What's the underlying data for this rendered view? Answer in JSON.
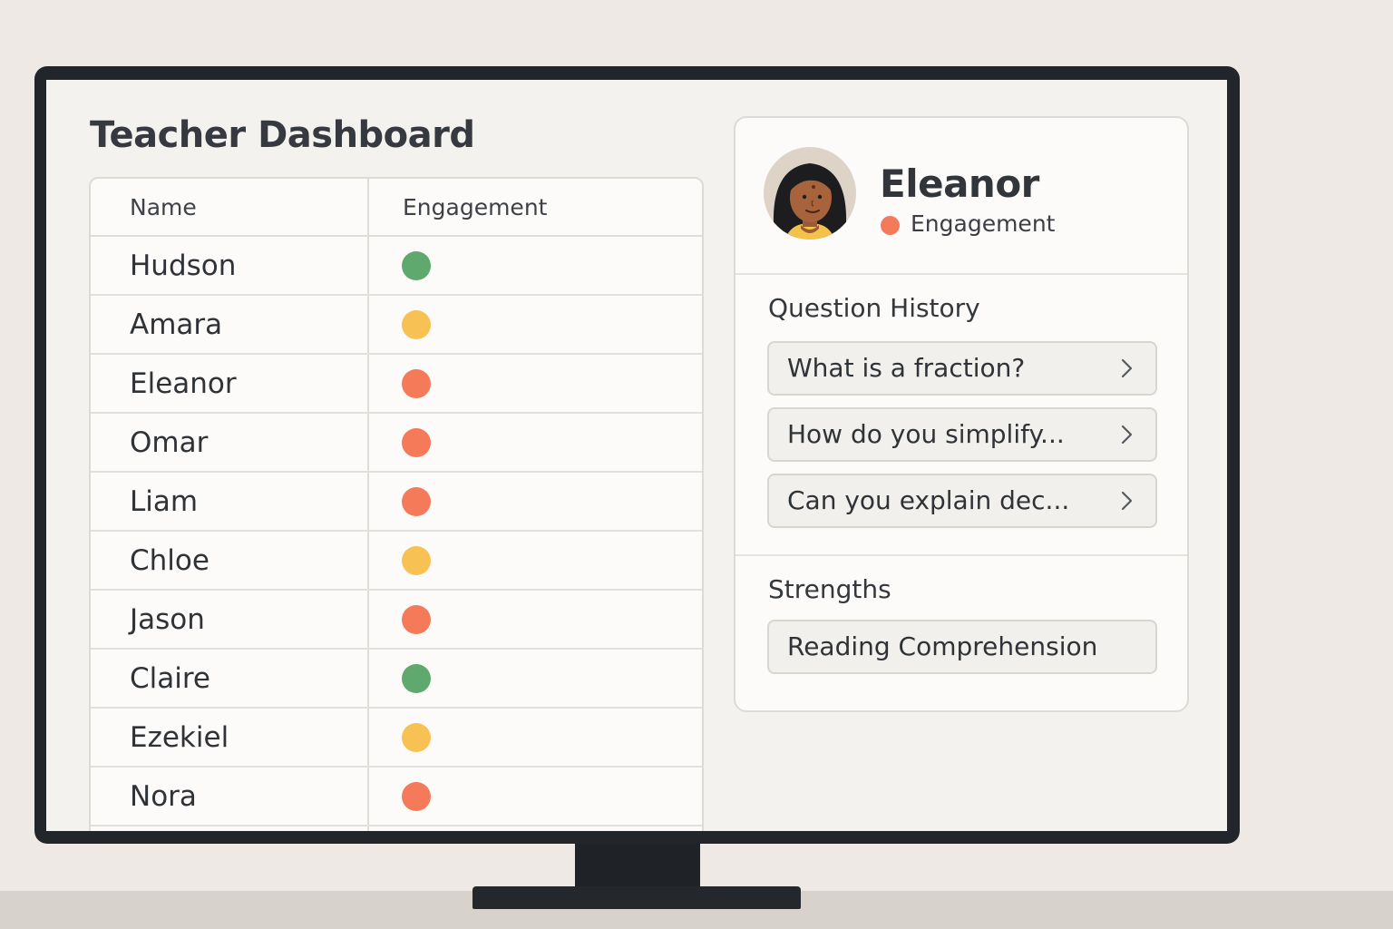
{
  "dashboard": {
    "title": "Teacher Dashboard"
  },
  "table": {
    "columns": [
      "Name",
      "Engagement"
    ],
    "rows": [
      {
        "name": "Hudson",
        "engagement": "green"
      },
      {
        "name": "Amara",
        "engagement": "yellow"
      },
      {
        "name": "Eleanor",
        "engagement": "red"
      },
      {
        "name": "Omar",
        "engagement": "red"
      },
      {
        "name": "Liam",
        "engagement": "red"
      },
      {
        "name": "Chloe",
        "engagement": "yellow"
      },
      {
        "name": "Jason",
        "engagement": "red"
      },
      {
        "name": "Claire",
        "engagement": "green"
      },
      {
        "name": "Ezekiel",
        "engagement": "yellow"
      },
      {
        "name": "Nora",
        "engagement": "red"
      }
    ]
  },
  "colors": {
    "green": "#5fa86e",
    "yellow": "#f7c253",
    "red": "#f47a5a"
  },
  "profile": {
    "name": "Eleanor",
    "engagement_label": "Engagement",
    "engagement": "red",
    "avatar_icon": "student-avatar"
  },
  "question_history": {
    "title": "Question History",
    "items": [
      {
        "label": "What is a fraction?",
        "icon": "chevron-right-icon"
      },
      {
        "label": "How do you simplify...",
        "icon": "chevron-right-icon"
      },
      {
        "label": "Can you explain dec...",
        "icon": "chevron-right-icon"
      }
    ]
  },
  "strengths": {
    "title": "Strengths",
    "items": [
      {
        "label": "Reading Comprehension"
      }
    ]
  }
}
